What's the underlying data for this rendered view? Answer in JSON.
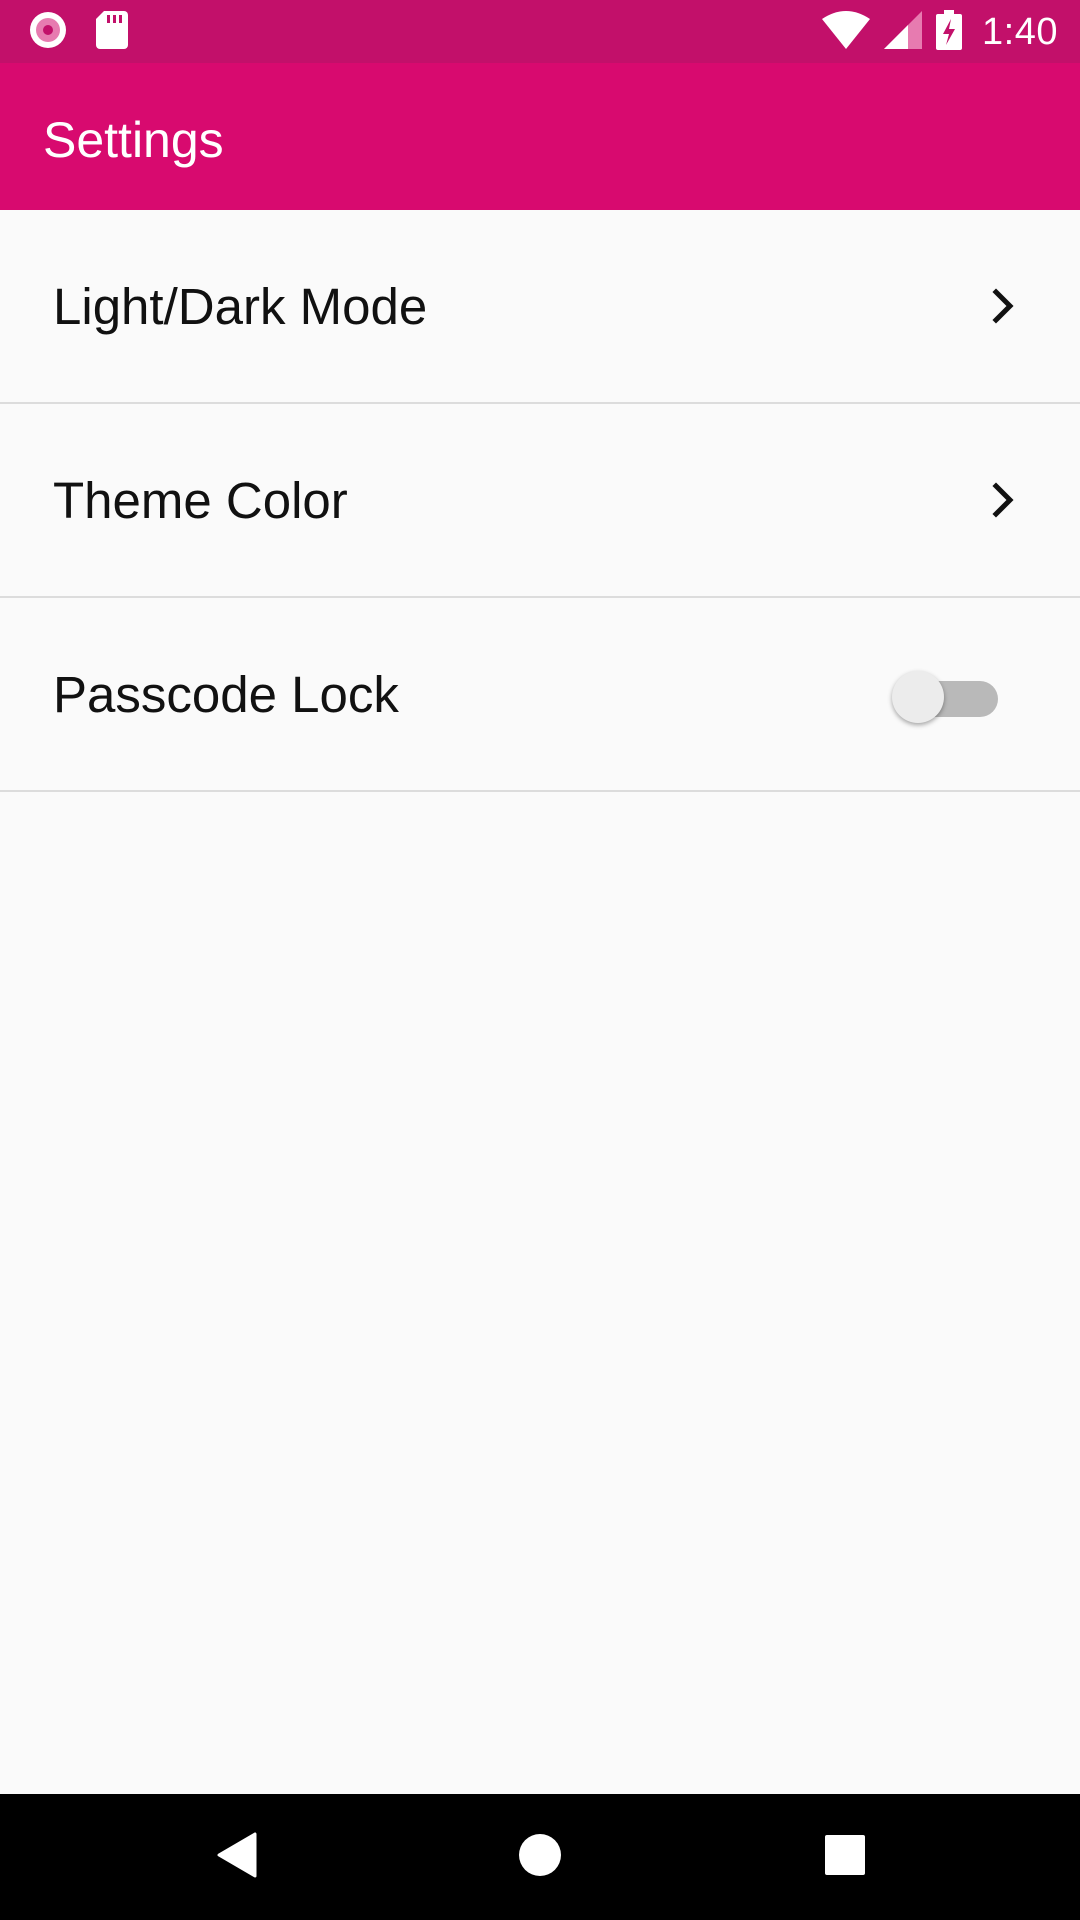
{
  "status_bar": {
    "time": "1:40",
    "icons": [
      "record-icon",
      "sd-card-icon",
      "wifi-icon",
      "cell-signal-icon",
      "battery-charging-icon"
    ],
    "background_color": "#c2106a"
  },
  "app_bar": {
    "title": "Settings",
    "background_color": "#d80a6f"
  },
  "settings": {
    "items": [
      {
        "label": "Light/Dark Mode",
        "control": "chevron-right-icon"
      },
      {
        "label": "Theme Color",
        "control": "chevron-right-icon"
      },
      {
        "label": "Passcode Lock",
        "control": "toggle",
        "enabled": false
      }
    ]
  },
  "nav_bar": {
    "buttons": [
      "back-icon",
      "home-icon",
      "recents-icon"
    ]
  }
}
